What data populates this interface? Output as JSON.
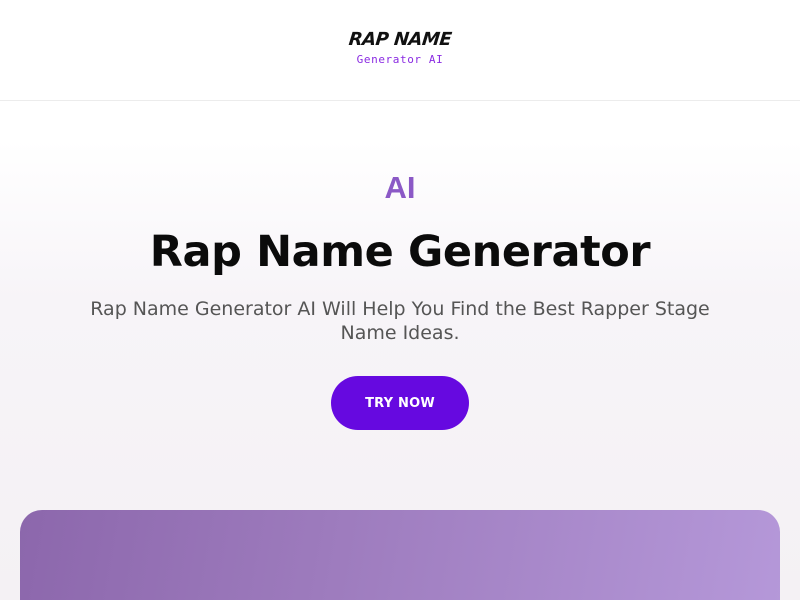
{
  "header": {
    "logo": {
      "top_text": "RAP NAME",
      "bottom_text": "Generator AI"
    }
  },
  "hero": {
    "eyebrow": "AI",
    "title": "Rap Name Generator",
    "subtitle": "Rap Name Generator AI Will Help You Find the Best Rapper Stage Name Ideas.",
    "cta_label": "TRY NOW"
  },
  "colors": {
    "brand_purple": "#6609e0",
    "eyebrow_purple": "#8b59c6",
    "card_gradient_start": "#8c67ac",
    "card_gradient_end": "#b598d9"
  }
}
